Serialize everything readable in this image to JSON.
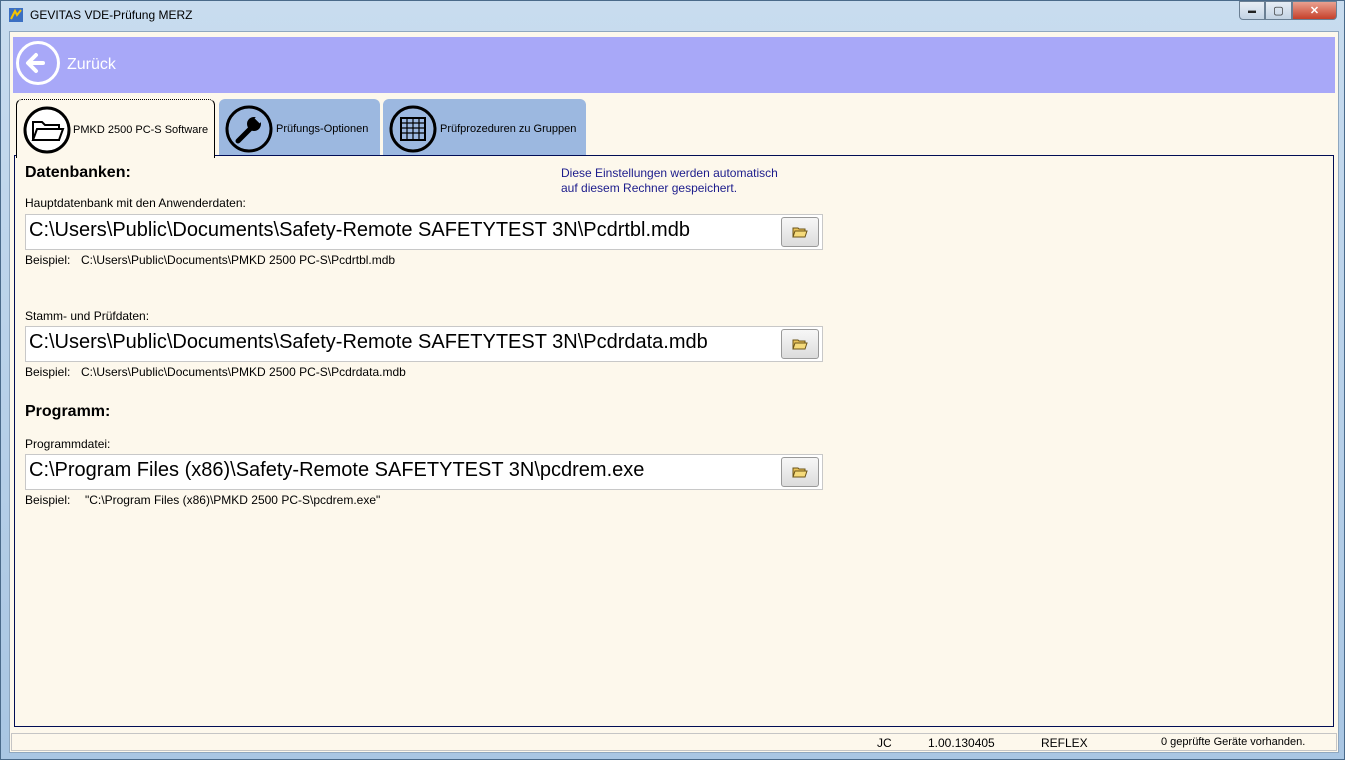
{
  "window": {
    "title": "GEVITAS VDE-Prüfung MERZ",
    "min_glyph": "▬",
    "max_glyph": "▢",
    "close_glyph": "✕"
  },
  "header": {
    "back_label": "Zurück"
  },
  "tabs": [
    {
      "label": "PMKD 2500 PC-S Software",
      "icon": "folder-icon",
      "active": true
    },
    {
      "label": "Prüfungs-Optionen",
      "icon": "wrench-icon",
      "active": false
    },
    {
      "label": "Prüfprozeduren zu Gruppen",
      "icon": "table-icon",
      "active": false
    }
  ],
  "panel": {
    "databases_heading": "Datenbanken:",
    "note_line1": "Diese Einstellungen werden automatisch",
    "note_line2": "auf diesem Rechner gespeichert.",
    "main_db": {
      "label": "Hauptdatenbank mit den Anwenderdaten:",
      "value": "C:\\Users\\Public\\Documents\\Safety-Remote SAFETYTEST 3N\\Pcdrtbl.mdb",
      "example_label": "Beispiel:",
      "example_value": "C:\\Users\\Public\\Documents\\PMKD 2500 PC-S\\Pcdrtbl.mdb"
    },
    "master_db": {
      "label": "Stamm- und Prüfdaten:",
      "value": "C:\\Users\\Public\\Documents\\Safety-Remote SAFETYTEST 3N\\Pcdrdata.mdb",
      "example_label": "Beispiel:",
      "example_value": "C:\\Users\\Public\\Documents\\PMKD 2500 PC-S\\Pcdrdata.mdb"
    },
    "program_heading": "Programm:",
    "program": {
      "label": "Programmdatei:",
      "value": "C:\\Program Files (x86)\\Safety-Remote SAFETYTEST 3N\\pcdrem.exe",
      "example_label": "Beispiel:",
      "example_value": "\"C:\\Program Files (x86)\\PMKD 2500 PC-S\\pcdrem.exe\""
    }
  },
  "status": {
    "user": "JC",
    "version": "1.00.130405",
    "mode": "REFLEX",
    "devices": "0 geprüfte Geräte vorhanden."
  },
  "colors": {
    "header_bg": "#a8a8f8",
    "tab_bg": "#9cb8e0",
    "panel_bg": "#fdf8ec",
    "note_text": "#1c1c8c"
  }
}
